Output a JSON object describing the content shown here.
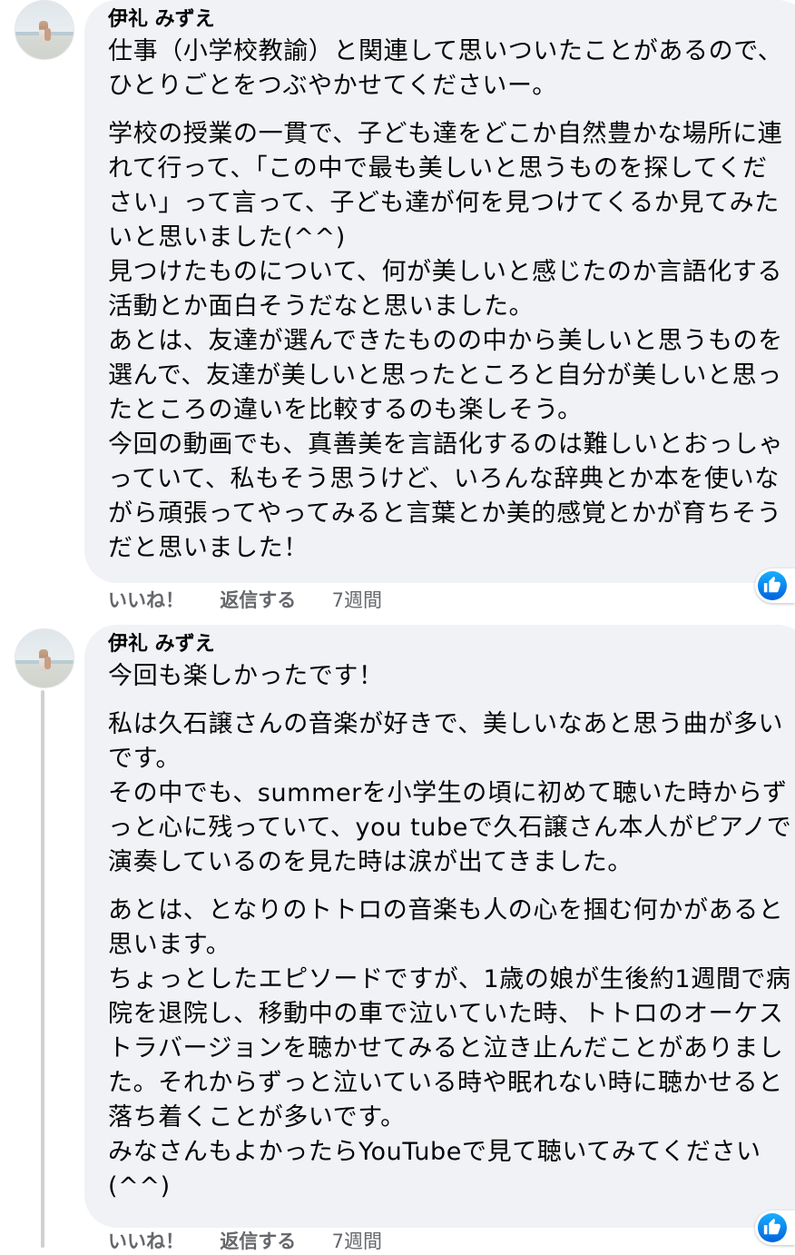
{
  "comments": [
    {
      "author": "伊礼 みずえ",
      "paragraphs": [
        "仕事（小学校教諭）と関連して思いついたことがあるので、\nひとりごとをつぶやかせてくださいー。",
        "学校の授業の一貫で、子ども達をどこか自然豊かな場所に連\nれて行って、「この中で最も美しいと思うものを探してくだ\nさい」って言って、子ども達が何を見つけてくるか見てみた\nいと思いました(^^)\n見つけたものについて、何が美しいと感じたのか言語化する\n活動とか面白そうだなと思いました。\nあとは、友達が選んできたものの中から美しいと思うものを\n選んで、友達が美しいと思ったところと自分が美しいと思っ\nたところの違いを比較するのも楽しそう。\n今回の動画でも、真善美を言語化するのは難しいとおっしゃ\nっていて、私もそう思うけど、いろんな辞典とか本を使いな\nがら頑張ってやってみると言葉とか美的感覚とかが育ちそう\nだと思いました！"
      ],
      "actions": {
        "like": "いいね！",
        "reply": "返信する",
        "time": "7週間"
      }
    },
    {
      "author": "伊礼 みずえ",
      "paragraphs": [
        "今回も楽しかったです！",
        "私は久石譲さんの音楽が好きで、美しいなあと思う曲が多い\nです。\nその中でも、summerを小学生の頃に初めて聴いた時からず\nっと心に残っていて、you tubeで久石譲さん本人がピアノで\n演奏しているのを見た時は涙が出てきました。",
        "あとは、となりのトトロの音楽も人の心を掴む何かがあると\n思います。\nちょっとしたエピソードですが、1歳の娘が生後約1週間で病\n院を退院し、移動中の車で泣いていた時、トトロのオーケス\nトラバージョンを聴かせてみると泣き止んだことがありまし\nた。それからずっと泣いている時や眠れない時に聴かせると\n落ち着くことが多いです。\nみなさんもよかったらYouTubeで見て聴いてみてください\n(^^)"
      ],
      "actions": {
        "like": "いいね！",
        "reply": "返信する",
        "time": "7週間"
      }
    }
  ],
  "icons": {
    "reaction": "thumbs-up-icon",
    "reaction_color": "#1877f2"
  }
}
